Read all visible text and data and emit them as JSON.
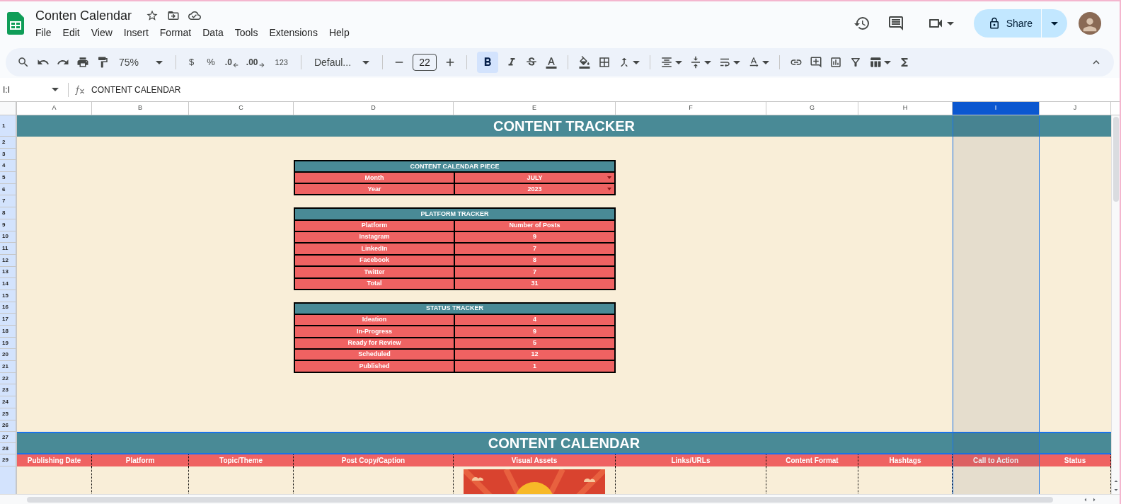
{
  "doc": {
    "title": "Conten Calendar"
  },
  "menu": [
    "File",
    "Edit",
    "View",
    "Insert",
    "Format",
    "Data",
    "Tools",
    "Extensions",
    "Help"
  ],
  "share": {
    "label": "Share"
  },
  "toolbar": {
    "zoom": "75%",
    "currency": "$",
    "percent": "%",
    "decrease_decimal": ".0",
    "increase_decimal": ".00",
    "number_format": "123",
    "font": "Defaul...",
    "font_size": "22",
    "bold": {
      "selected": true
    }
  },
  "formula_bar": {
    "name_box": "I:I",
    "formula": "CONTENT CALENDAR"
  },
  "columns": [
    {
      "label": "A",
      "selected": false
    },
    {
      "label": "B",
      "selected": false
    },
    {
      "label": "C",
      "selected": false
    },
    {
      "label": "D",
      "selected": false
    },
    {
      "label": "E",
      "selected": false
    },
    {
      "label": "F",
      "selected": false
    },
    {
      "label": "G",
      "selected": false
    },
    {
      "label": "H",
      "selected": false
    },
    {
      "label": "I",
      "selected": true
    },
    {
      "label": "J",
      "selected": false
    }
  ],
  "row_numbers": [
    "1",
    "2",
    "3",
    "4",
    "5",
    "6",
    "7",
    "8",
    "9",
    "10",
    "11",
    "12",
    "13",
    "14",
    "15",
    "16",
    "17",
    "18",
    "19",
    "20",
    "21",
    "22",
    "23",
    "24",
    "25",
    "26",
    "27",
    "28",
    "29"
  ],
  "tracker_title": "CONTENT TRACKER",
  "tables": [
    {
      "title": "CONTENT CALENDAR PIECE",
      "rows": [
        {
          "label": "Month",
          "value": "JULY",
          "kind": "dropdown"
        },
        {
          "label": "Year",
          "value": "2023",
          "kind": "dropdown"
        }
      ]
    },
    {
      "title": "PLATFORM TRACKER",
      "rows": [
        {
          "label": "Platform",
          "value": "Number of Posts",
          "kind": "plain"
        },
        {
          "label": "Instagram",
          "value": "9",
          "kind": "plain"
        },
        {
          "label": "LinkedIn",
          "value": "7",
          "kind": "plain"
        },
        {
          "label": "Facebook",
          "value": "8",
          "kind": "plain"
        },
        {
          "label": "Twitter",
          "value": "7",
          "kind": "plain"
        },
        {
          "label": "Total",
          "value": "31",
          "kind": "plain"
        }
      ]
    },
    {
      "title": "STATUS TRACKER",
      "rows": [
        {
          "label": "Ideation",
          "value": "4",
          "kind": "plain"
        },
        {
          "label": "In-Progress",
          "value": "9",
          "kind": "plain"
        },
        {
          "label": "Ready for Review",
          "value": "5",
          "kind": "plain"
        },
        {
          "label": "Scheduled",
          "value": "12",
          "kind": "plain"
        },
        {
          "label": "Published",
          "value": "1",
          "kind": "plain"
        }
      ]
    }
  ],
  "calendar_title": "CONTENT CALENDAR",
  "calendar_headers": [
    "Publishing Date",
    "Platform",
    "Topic/Theme",
    "Post Copy/Caption",
    "Visual Assets",
    "Links/URLs",
    "Content Format",
    "Hashtags",
    "Call to Action",
    "Status"
  ]
}
